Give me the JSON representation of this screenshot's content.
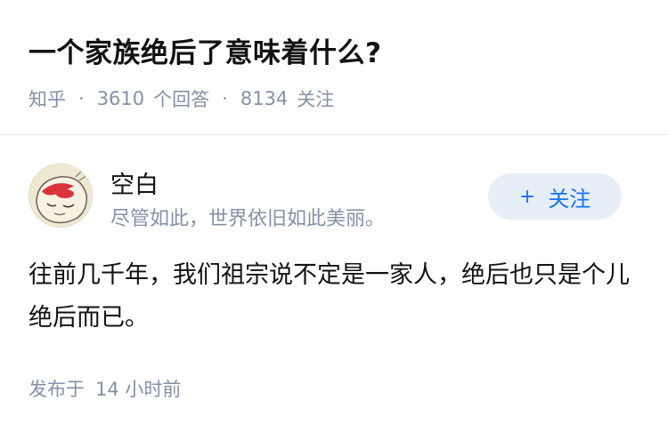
{
  "question": {
    "title": "一个家族绝后了意味着什么?",
    "source": "知乎",
    "answer_count": "3610",
    "answer_label": "个回答",
    "follower_count": "8134",
    "follower_label": "关注",
    "separator": "·"
  },
  "author": {
    "name": "空白",
    "bio": "尽管如此，世界依旧如此美丽。",
    "avatar_icon": "cartoon-character-avatar"
  },
  "follow_button": {
    "icon": "+",
    "label": "关注"
  },
  "answer": {
    "content": "往前几千年，我们祖宗说不定是一家人，绝后也只是个儿绝后而已。",
    "posted_prefix": "发布于",
    "posted_time": "14 小时前"
  },
  "colors": {
    "accent": "#1772f6",
    "button_bg": "#e6eef8",
    "meta": "#8590a6",
    "text": "#121212"
  }
}
